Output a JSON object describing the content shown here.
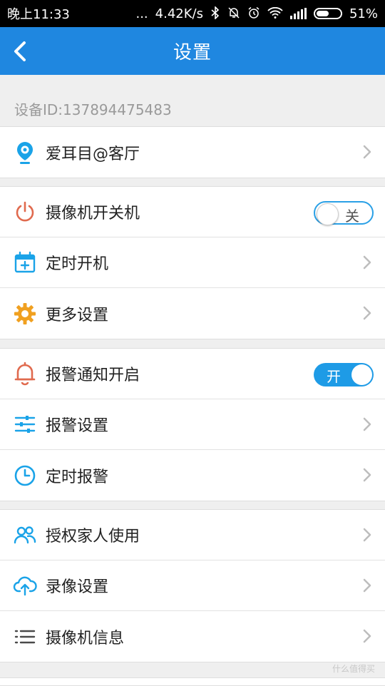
{
  "status_bar": {
    "time": "晚上11:33",
    "dots": "...",
    "speed": "4.42K/s",
    "battery": "51%"
  },
  "nav": {
    "title": "设置"
  },
  "device_id": "设备ID:137894475483",
  "groups": [
    {
      "items": [
        {
          "label": "爱耳目@客厅",
          "icon": "camera-pin-icon"
        }
      ]
    },
    {
      "items": [
        {
          "label": "摄像机开关机",
          "icon": "power-icon",
          "toggle": {
            "state": "off",
            "text": "关"
          }
        },
        {
          "label": "定时开机",
          "icon": "calendar-add-icon"
        },
        {
          "label": "更多设置",
          "icon": "gear-icon"
        }
      ]
    },
    {
      "items": [
        {
          "label": "报警通知开启",
          "icon": "bell-icon",
          "toggle": {
            "state": "on",
            "text": "开"
          }
        },
        {
          "label": "报警设置",
          "icon": "sliders-icon"
        },
        {
          "label": "定时报警",
          "icon": "clock-icon"
        }
      ]
    },
    {
      "items": [
        {
          "label": "授权家人使用",
          "icon": "users-icon"
        },
        {
          "label": "录像设置",
          "icon": "cloud-upload-icon"
        },
        {
          "label": "摄像机信息",
          "icon": "list-icon"
        }
      ]
    }
  ],
  "watermark": "什么值得买",
  "colors": {
    "nav_blue": "#1f87e0",
    "toggle_blue": "#1e9be6",
    "icon_red": "#e06a4e",
    "icon_orange": "#f0a020",
    "icon_blue": "#1aa3e8"
  }
}
